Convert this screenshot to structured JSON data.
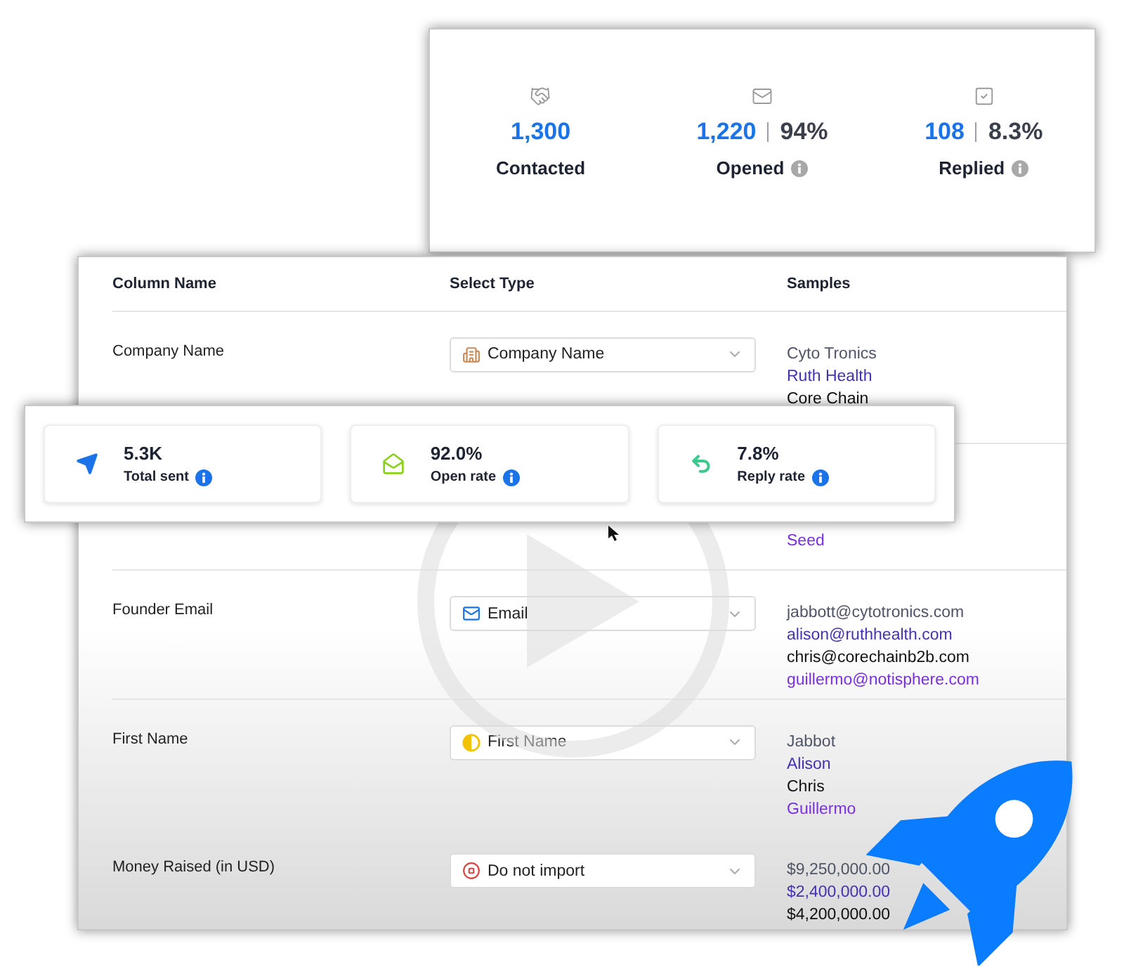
{
  "summary": {
    "metrics": [
      {
        "kind": "contacted",
        "value": "1,300",
        "label": "Contacted",
        "info": false
      },
      {
        "kind": "opened",
        "value": "1,220",
        "percent": "94%",
        "label": "Opened",
        "info": true
      },
      {
        "kind": "replied",
        "value": "108",
        "percent": "8.3%",
        "label": "Replied",
        "info": true
      }
    ]
  },
  "table": {
    "columns": [
      "Column Name",
      "Select Type",
      "Samples"
    ],
    "rows": [
      {
        "name": "Company Name",
        "type": {
          "kind": "company",
          "label": "Company Name"
        },
        "samples": [
          "Cyto Tronics",
          "Ruth Health",
          "Core Chain"
        ]
      },
      {
        "samples": [
          "Seed"
        ]
      },
      {
        "name": "Founder Email",
        "type": {
          "kind": "email",
          "label": "Email"
        },
        "samples": [
          "jabbott@cytotronics.com",
          "alison@ruthhealth.com",
          "chris@corechainb2b.com",
          "guillermo@notisphere.com"
        ]
      },
      {
        "name": "First Name",
        "type": {
          "kind": "first_name",
          "label": "First Name"
        },
        "samples": [
          "Jabbot",
          "Alison",
          "Chris",
          "Guillermo"
        ]
      },
      {
        "name": "Money Raised (in USD)",
        "type": {
          "kind": "skip",
          "label": "Do not import"
        },
        "samples": [
          "$9,250,000.00",
          "$2,400,000.00",
          "$4,200,000.00"
        ]
      }
    ]
  },
  "stats": [
    {
      "kind": "sent",
      "value": "5.3K",
      "label": "Total sent"
    },
    {
      "kind": "open",
      "value": "92.0%",
      "label": "Open rate"
    },
    {
      "kind": "reply",
      "value": "7.8%",
      "label": "Reply rate"
    }
  ]
}
